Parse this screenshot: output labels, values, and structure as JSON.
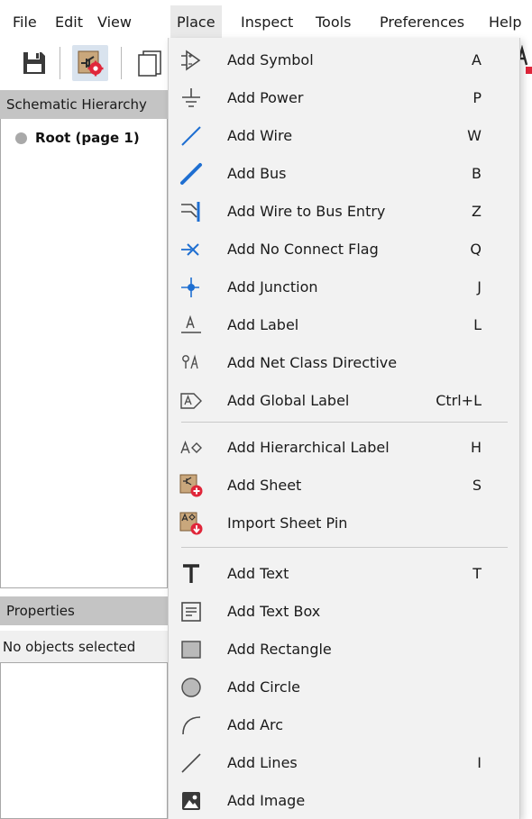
{
  "menubar": {
    "items": [
      {
        "label": "File"
      },
      {
        "label": "Edit"
      },
      {
        "label": "View"
      },
      {
        "label": "Place"
      },
      {
        "label": "Inspect"
      },
      {
        "label": "Tools"
      },
      {
        "label": "Preferences"
      },
      {
        "label": "Help"
      }
    ],
    "active": "Place"
  },
  "toolbar": {
    "icons": [
      "save-icon",
      "symbol-editor-icon",
      "page-setup-icon"
    ]
  },
  "hierarchy_panel": {
    "title": "Schematic Hierarchy",
    "root_label": "Root (page 1)"
  },
  "properties_panel": {
    "title": "Properties",
    "status": "No objects selected"
  },
  "place_menu": {
    "groups": [
      [
        {
          "label": "Add Symbol",
          "shortcut": "A",
          "icon": "add-symbol-icon"
        },
        {
          "label": "Add Power",
          "shortcut": "P",
          "icon": "add-power-icon"
        },
        {
          "label": "Add Wire",
          "shortcut": "W",
          "icon": "add-wire-icon"
        },
        {
          "label": "Add Bus",
          "shortcut": "B",
          "icon": "add-bus-icon"
        },
        {
          "label": "Add Wire to Bus Entry",
          "shortcut": "Z",
          "icon": "wire-to-bus-entry-icon"
        },
        {
          "label": "Add No Connect Flag",
          "shortcut": "Q",
          "icon": "no-connect-flag-icon"
        },
        {
          "label": "Add Junction",
          "shortcut": "J",
          "icon": "junction-icon"
        },
        {
          "label": "Add Label",
          "shortcut": "L",
          "icon": "label-icon"
        },
        {
          "label": "Add Net Class Directive",
          "shortcut": "",
          "icon": "net-class-directive-icon"
        },
        {
          "label": "Add Global Label",
          "shortcut": "Ctrl+L",
          "icon": "global-label-icon"
        }
      ],
      [
        {
          "label": "Add Hierarchical Label",
          "shortcut": "H",
          "icon": "hierarchical-label-icon"
        },
        {
          "label": "Add Sheet",
          "shortcut": "S",
          "icon": "add-sheet-icon"
        },
        {
          "label": "Import Sheet Pin",
          "shortcut": "",
          "icon": "import-sheet-pin-icon"
        }
      ],
      [
        {
          "label": "Add Text",
          "shortcut": "T",
          "icon": "text-icon"
        },
        {
          "label": "Add Text Box",
          "shortcut": "",
          "icon": "text-box-icon"
        },
        {
          "label": "Add Rectangle",
          "shortcut": "",
          "icon": "rectangle-icon"
        },
        {
          "label": "Add Circle",
          "shortcut": "",
          "icon": "circle-icon"
        },
        {
          "label": "Add Arc",
          "shortcut": "",
          "icon": "arc-icon"
        },
        {
          "label": "Add Lines",
          "shortcut": "I",
          "icon": "lines-icon"
        },
        {
          "label": "Add Image",
          "shortcut": "",
          "icon": "image-icon"
        }
      ]
    ]
  },
  "colors": {
    "wire_blue": "#1f6fd1",
    "sheet_red": "#e0263a",
    "icon_gray": "#4a4a4a",
    "menu_bg": "#f2f2f2",
    "panel_header_bg": "#c4c4c4",
    "toolbar_pressed_bg": "#d9e3ee"
  }
}
